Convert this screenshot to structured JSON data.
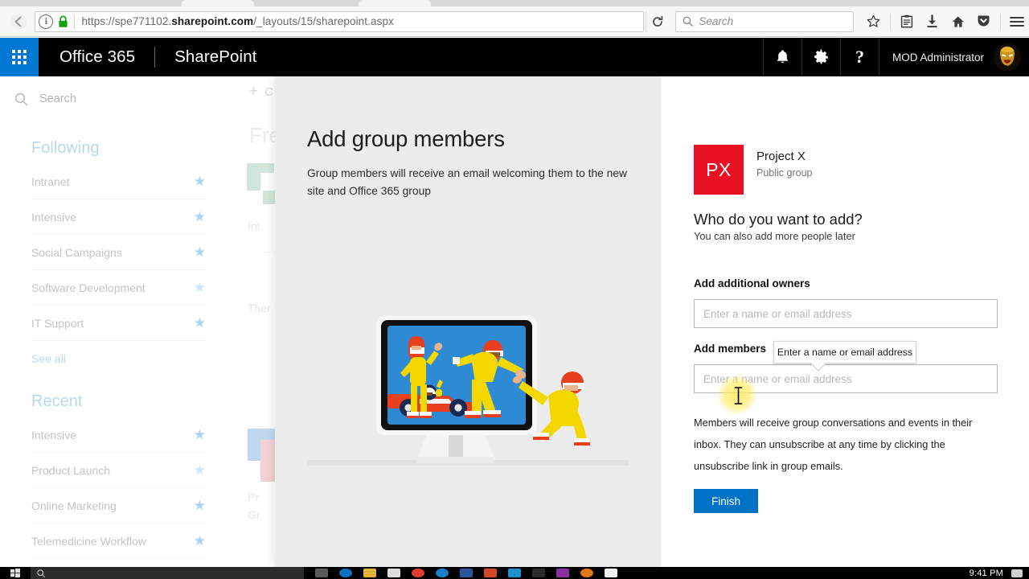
{
  "browser": {
    "url_prefix": "https://spe771102.",
    "url_domain": "sharepoint.com",
    "url_suffix": "/_layouts/15/sharepoint.aspx",
    "search_placeholder": "Search",
    "back_icon": "back-arrow-icon",
    "info_icon": "info-icon",
    "lock_icon": "lock-icon",
    "reload_icon": "reload-icon",
    "search_icon": "search-icon",
    "bookmark_icon": "star-icon",
    "library_icon": "library-icon",
    "downloads_icon": "download-icon",
    "home_icon": "home-icon",
    "pocket_icon": "pocket-icon",
    "menu_icon": "hamburger-menu-icon"
  },
  "suitebar": {
    "waffle": "app-launcher-icon",
    "brand": "Office 365",
    "app_name": "SharePoint",
    "notifications_icon": "bell-icon",
    "settings_icon": "gear-icon",
    "help_icon": "question-mark-icon",
    "user_name": "MOD Administrator",
    "avatar": "user-avatar",
    "background": "#000000",
    "waffle_bg": "#0078d4"
  },
  "leftnav": {
    "search_placeholder": "Search",
    "search_icon": "search-icon",
    "following_header": "Following",
    "following": [
      {
        "label": "Intranet",
        "star": "star-icon"
      },
      {
        "label": "Intensive",
        "star": "star-icon"
      },
      {
        "label": "Social Campaigns",
        "star": "star-icon"
      },
      {
        "label": "Software Development",
        "star": "star-icon"
      },
      {
        "label": "IT Support",
        "star": "star-icon"
      }
    ],
    "see_all": "See all",
    "recent_header": "Recent",
    "recent": [
      {
        "label": "Intensive",
        "star": "star-icon"
      },
      {
        "label": "Product Launch",
        "star": "star-icon"
      },
      {
        "label": "Online Marketing",
        "star": "star-icon"
      },
      {
        "label": "Telemedicine Workflow",
        "star": "star-icon"
      }
    ]
  },
  "background_page": {
    "create_label": "C",
    "frequent_header": "Fre",
    "item1": "Int",
    "item2": "Ther",
    "item3_line1": "Pr",
    "item3_line2": "Gr"
  },
  "panel": {
    "title": "Add group members",
    "subtitle": "Group members will receive an email welcoming them to the new site and Office 365 group",
    "illustration": "racing-team-monitor-illustration"
  },
  "group": {
    "initials": "PX",
    "logo_color": "#e81123",
    "name": "Project X",
    "privacy": "Public group"
  },
  "form": {
    "question": "Who do you want to add?",
    "question_sub": "You can also add more people later",
    "owners_label": "Add additional owners",
    "owners_placeholder": "Enter a name or email address",
    "owners_value": "",
    "members_label": "Add members",
    "members_placeholder": "Enter a name or email address",
    "members_value": "",
    "note": "Members will receive group conversations and events in their inbox. They can unsubscribe at any time by clicking the unsubscribe link in group emails.",
    "finish_label": "Finish",
    "finish_color": "#0072c6"
  },
  "tooltip": {
    "text": "Enter a name or email address"
  },
  "taskbar": {
    "start_icon": "windows-start-icon",
    "search_icon": "search-icon",
    "search_placeholder": "",
    "clock": "9:41 PM",
    "notification_icon": "notifications-icon"
  }
}
